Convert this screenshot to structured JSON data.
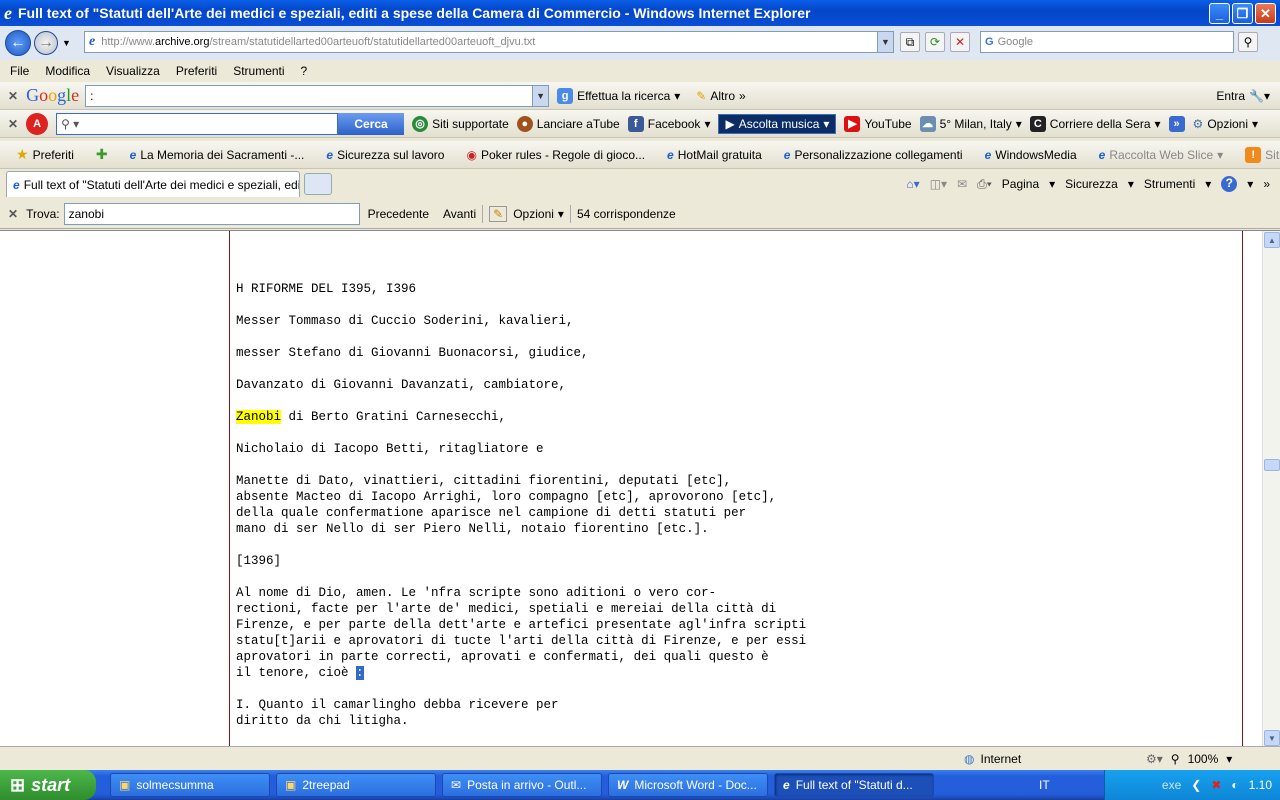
{
  "window": {
    "title": "Full text of \"Statuti dell'Arte dei medici e speziali, editi a spese della Camera di Commercio  - Windows Internet Explorer"
  },
  "address": {
    "url_prefix": "http://www.",
    "url_domain": "archive.org",
    "url_path": "/stream/statutidellarted00arteuoft/statutidellarted00arteuoft_djvu.txt",
    "search_placeholder": "Google"
  },
  "menu": [
    "File",
    "Modifica",
    "Visualizza",
    "Preferiti",
    "Strumenti",
    "?"
  ],
  "google_toolbar": {
    "query": ":",
    "effettua": "Effettua la ricerca",
    "altro": "Altro",
    "entra": "Entra"
  },
  "ask_toolbar": {
    "cerca": "Cerca",
    "items": [
      "Siti supportate",
      "Lanciare aTube",
      "Facebook",
      "Ascolta musica",
      "YouTube",
      "5° Milan, Italy",
      "Corriere della Sera",
      "Opzioni"
    ]
  },
  "favorites": {
    "label": "Preferiti",
    "items": [
      "La Memoria dei Sacramenti -...",
      "Sicurezza sul lavoro",
      "Poker rules - Regole di gioco...",
      "HotMail gratuita",
      "Personalizzazione collegamenti",
      "WindowsMedia",
      "Raccolta Web Slice",
      "Siti suggeriti"
    ]
  },
  "tab": {
    "label": "Full text of \"Statuti dell'Arte dei medici e speziali, editi ..."
  },
  "command_bar": [
    "Pagina",
    "Sicurezza",
    "Strumenti"
  ],
  "find": {
    "label": "Trova:",
    "value": "zanobi",
    "prev": "Precedente",
    "next": "Avanti",
    "options": "Opzioni",
    "matches": "54 corrispondenze"
  },
  "document": {
    "lines": [
      {
        "text": "H RIFORME DEL I395, I396"
      },
      {
        "text": ""
      },
      {
        "text": "Messer Tommaso di Cuccio Soderini, kavalieri,"
      },
      {
        "text": ""
      },
      {
        "text": "messer Stefano di Giovanni Buonacorsi, giudice,"
      },
      {
        "text": ""
      },
      {
        "text": "Davanzato di Giovanni Davanzati, cambiatore,"
      },
      {
        "text": ""
      },
      {
        "highlight": "Zanobi",
        "rest": " di Berto Gratini Carnesecchi,"
      },
      {
        "text": ""
      },
      {
        "text": "Nicholaio di Iacopo Betti, ritagliatore e"
      },
      {
        "text": ""
      },
      {
        "text": "Manette di Dato, vinattieri, cittadini fiorentini, deputati [etc],"
      },
      {
        "text": "absente Macteo di Iacopo Arrighi, loro compagno [etc], aprovorono [etc],"
      },
      {
        "text": "della quale confermatione aparisce nel campione di detti statuti per"
      },
      {
        "text": "mano di ser Nello di ser Piero Nelli, notaio fiorentino [etc.]."
      },
      {
        "text": ""
      },
      {
        "text": "[1396]"
      },
      {
        "text": ""
      },
      {
        "text": "Al nome di Dio, amen. Le 'nfra scripte sono aditioni o vero cor-"
      },
      {
        "text": "rectioni, facte per l'arte de' medici, spetiali e mereiai della città di"
      },
      {
        "text": "Firenze, e per parte della dett'arte e artefici presentate agl'infra scripti"
      },
      {
        "text": "statu[t]arii e aprovatori di tucte l'arti della città di Firenze, e per essi"
      },
      {
        "text": "aprovatori in parte correcti, aprovati e confermati, dei quali questo è"
      },
      {
        "pre": "il tenore, cioè ",
        "selected": ":"
      },
      {
        "text": ""
      },
      {
        "text": "I. Quanto il camarlingho debba ricevere per"
      },
      {
        "text": "diritto da chi litigha."
      }
    ]
  },
  "status": {
    "zone": "Internet",
    "zoom": "100%"
  },
  "taskbar": {
    "start": "start",
    "buttons": [
      "solmecsumma",
      "2treepad",
      "Posta in arrivo - Outl...",
      "Microsoft Word - Doc...",
      "Full text of \"Statuti d..."
    ],
    "lang": "IT",
    "exe": "exe",
    "clock": "1.10"
  },
  "colors": {
    "find_highlight": "#ffff00",
    "selection": "#316ac5",
    "title_blue": "#0a5ee8"
  }
}
